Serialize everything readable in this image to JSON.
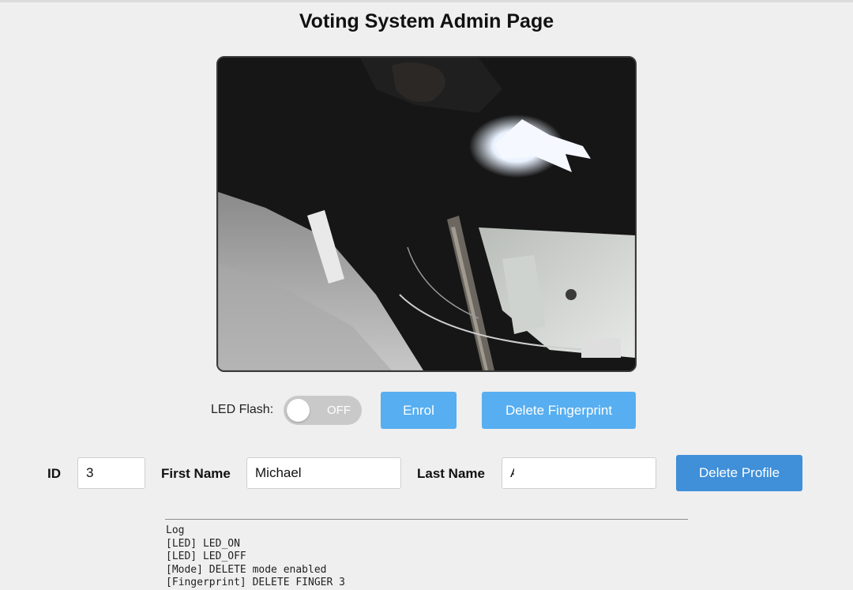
{
  "page": {
    "title": "Voting System Admin Page"
  },
  "camera": {
    "icon": "camera-feed"
  },
  "controls": {
    "led_label": "LED Flash:",
    "led_toggle_state": "OFF",
    "enrol_label": "Enrol",
    "delete_fingerprint_label": "Delete Fingerprint"
  },
  "profile": {
    "id_label": "ID",
    "id_value": "3",
    "first_name_label": "First Name",
    "first_name_value": "Michael",
    "last_name_label": "Last Name",
    "last_name_value": "A",
    "delete_profile_label": "Delete Profile"
  },
  "log": {
    "title": "Log",
    "lines": [
      "[LED] LED_ON",
      "[LED] LED_OFF",
      "[Mode] DELETE mode enabled",
      "[Fingerprint] DELETE FINGER 3"
    ]
  },
  "colors": {
    "background": "#efefef",
    "button_light": "#57aef0",
    "button_dark": "#3f8fd9",
    "toggle_off": "#c9c9c9"
  }
}
